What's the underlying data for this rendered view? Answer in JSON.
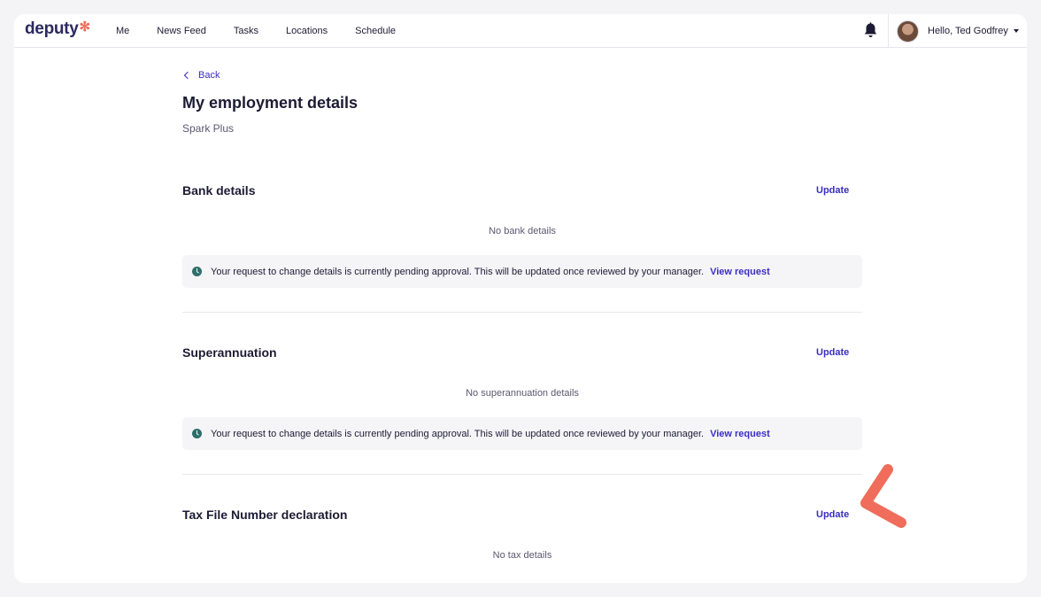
{
  "header": {
    "logo_text": "deputy",
    "nav": [
      "Me",
      "News Feed",
      "Tasks",
      "Locations",
      "Schedule"
    ],
    "user_greeting": "Hello, Ted Godfrey"
  },
  "page": {
    "back_label": "Back",
    "title": "My employment details",
    "subtitle": "Spark Plus"
  },
  "sections": [
    {
      "title": "Bank details",
      "update_label": "Update",
      "empty_text": "No bank details",
      "pending_text": "Your request to change details is currently pending approval. This will be updated once reviewed by your manager.",
      "view_request_label": "View request"
    },
    {
      "title": "Superannuation",
      "update_label": "Update",
      "empty_text": "No superannuation details",
      "pending_text": "Your request to change details is currently pending approval. This will be updated once reviewed by your manager.",
      "view_request_label": "View request"
    },
    {
      "title": "Tax File Number declaration",
      "update_label": "Update",
      "empty_text": "No tax details"
    }
  ],
  "icons": {
    "logo_mark": "asterisk-icon",
    "notifications": "bell-icon",
    "pending": "clock-icon",
    "back": "chevron-left-icon",
    "annotation": "arrow-pointer-annotation"
  },
  "colors": {
    "accent": "#3b2dc4",
    "brand": "#2b2960",
    "logo_star": "#ef6d5a",
    "annotation": "#ef6d5a",
    "pending_icon": "#2e6f6a"
  }
}
